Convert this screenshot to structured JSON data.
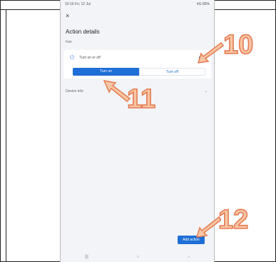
{
  "status_bar": {
    "left": "10:16  Fri, 12 Jul",
    "right": "4G 85%"
  },
  "screen": {
    "close_glyph": "×",
    "title": "Action details",
    "subtitle": "Fan",
    "row_label": "Turn on or off",
    "turn_on": "Turn on",
    "turn_off": "Turn off",
    "device_info": "Device info",
    "add_action": "Add action"
  },
  "annotations": {
    "c10": "10",
    "c11": "11",
    "c12": "12"
  },
  "nav": {
    "recent": "|||",
    "home": "○",
    "back": "‹"
  },
  "colors": {
    "accent": "#1e6fd6",
    "callout_fill": "#f7c6a4",
    "callout_stroke": "#e57b52"
  }
}
